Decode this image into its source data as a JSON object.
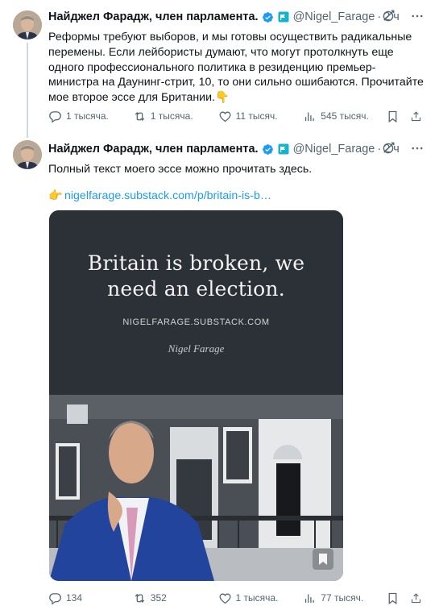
{
  "tweets": [
    {
      "author_name": "Найджел Фарадж, член парламента.",
      "handle": "@Nigel_Farage",
      "separator": "·",
      "time": "2 ч",
      "text": "Реформы требуют выборов, и мы готовы осуществить радикальные перемены. Если лейбористы думают, что могут протолкнуть еще одного профессионального политика в резиденцию премьер-министра на Даунинг-стрит, 10, то они сильно ошибаются. Прочитайте мое второе эссе для Британии.",
      "emoji": "👇",
      "stats": {
        "replies": "1 тысяча.",
        "reposts": "1 тысяча.",
        "likes": "11 тысяч.",
        "views": "545 тысяч."
      }
    },
    {
      "author_name": "Найджел Фарадж, член парламента.",
      "handle": "@Nigel_Farage",
      "separator": "·",
      "time": "2 ч",
      "text": "Полный текст моего эссе можно прочитать здесь.",
      "link_emoji": "👉",
      "link": "nigelfarage.substack.com/p/britain-is-b…",
      "card": {
        "title_line1": "Britain is broken, we",
        "title_line2": "need an election.",
        "url": "NIGELFARAGE.SUBSTACK.COM",
        "author": "Nigel Farage"
      },
      "stats": {
        "replies": "134",
        "reposts": "352",
        "likes": "1 тысяча.",
        "views": "77 тысяч."
      }
    }
  ],
  "colors": {
    "text": "#0f1419",
    "secondary": "#536471",
    "link": "#1d9bf0",
    "verified": "#1d9bf0",
    "card_bg": "#2c3137"
  },
  "icons": [
    "reply-icon",
    "repost-icon",
    "like-icon",
    "views-icon",
    "bookmark-icon",
    "share-icon",
    "grok-icon",
    "more-icon",
    "verified-badge-icon",
    "affiliate-flag-icon"
  ]
}
